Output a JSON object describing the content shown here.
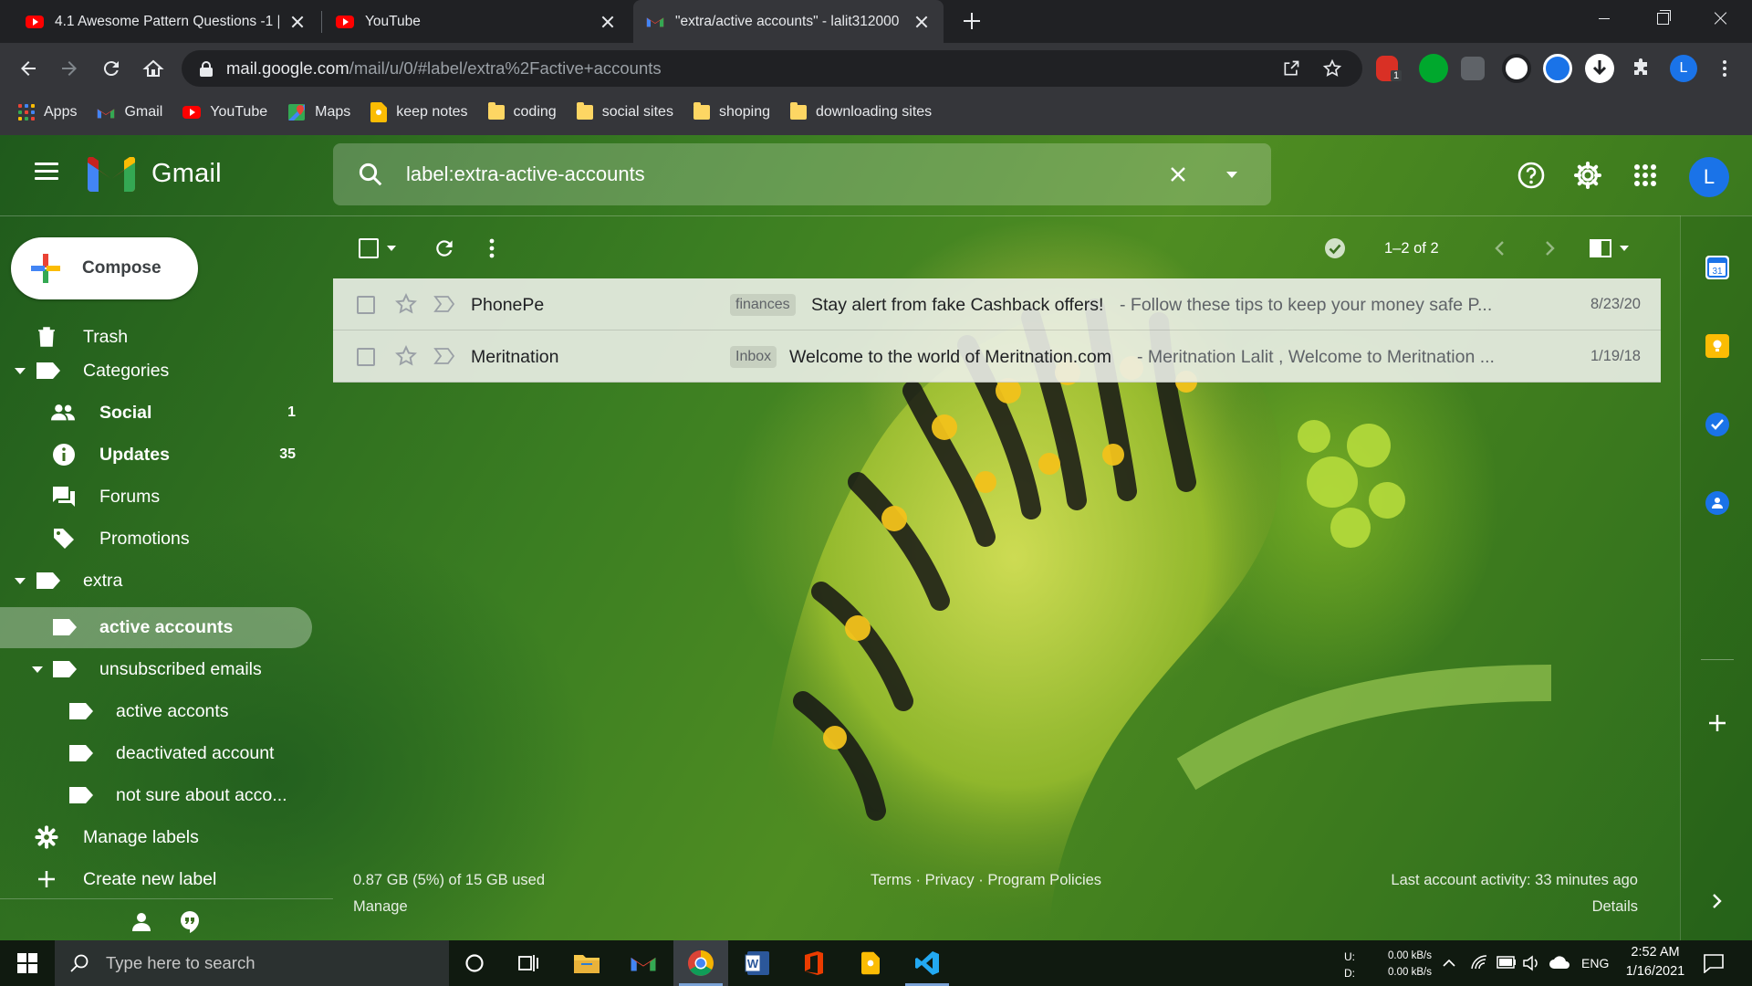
{
  "browser": {
    "tabs": [
      {
        "title": "4.1 Awesome Pattern Questions -1 |",
        "favicon": "youtube-icon",
        "active": false
      },
      {
        "title": "YouTube",
        "favicon": "youtube-icon",
        "active": false
      },
      {
        "title": "\"extra/active accounts\" - lalit312000",
        "favicon": "gmail-icon",
        "active": true
      }
    ],
    "url_host": "mail.google.com",
    "url_path": "/mail/u/0/#label/extra%2Factive+accounts",
    "profile_initial": "L",
    "extension_badge": "1",
    "bookmarks": [
      {
        "label": "Apps",
        "icon": "apps-icon"
      },
      {
        "label": "Gmail",
        "icon": "gmail-icon"
      },
      {
        "label": "YouTube",
        "icon": "youtube-icon"
      },
      {
        "label": "Maps",
        "icon": "maps-icon"
      },
      {
        "label": "keep notes",
        "icon": "keep-icon"
      },
      {
        "label": "coding",
        "icon": "folder-icon"
      },
      {
        "label": "social sites",
        "icon": "folder-icon"
      },
      {
        "label": "shoping",
        "icon": "folder-icon"
      },
      {
        "label": "downloading sites",
        "icon": "folder-icon"
      }
    ]
  },
  "gmail": {
    "product_name": "Gmail",
    "search_value": "label:extra-active-accounts",
    "account_initial": "L",
    "compose_label": "Compose",
    "nav": {
      "trash": "Trash",
      "categories": "Categories",
      "social": {
        "label": "Social",
        "count": "1"
      },
      "updates": {
        "label": "Updates",
        "count": "35"
      },
      "forums": "Forums",
      "promotions": "Promotions",
      "extra": "extra",
      "active_accounts": "active accounts",
      "unsubscribed_emails": "unsubscribed emails",
      "active_acconts": "active acconts",
      "deactivated_account": "deactivated account",
      "not_sure": "not sure about acco...",
      "manage_labels": "Manage labels",
      "create_label": "Create new label"
    },
    "pager_text": "1–2 of 2",
    "emails": [
      {
        "sender": "PhonePe",
        "label": "finances",
        "subject": "Stay alert from fake Cashback offers!",
        "snippet": " - Follow these tips to keep your money safe P...",
        "date": "8/23/20"
      },
      {
        "sender": "Meritnation",
        "label": "Inbox",
        "subject": "Welcome to the world of Meritnation.com",
        "snippet": " - Meritnation Lalit , Welcome to Meritnation ...",
        "date": "1/19/18"
      }
    ],
    "footer": {
      "storage": "0.87 GB (5%) of 15 GB used",
      "manage": "Manage",
      "links": "Terms · Privacy · Program Policies",
      "activity": "Last account activity: 33 minutes ago",
      "details": "Details"
    }
  },
  "taskbar": {
    "search_placeholder": "Type here to search",
    "net_up_label": "U:",
    "net_down_label": "D:",
    "net_up": "0.00 kB/s",
    "net_down": "0.00 kB/s",
    "language": "ENG",
    "time": "2:52 AM",
    "date": "1/16/2021"
  },
  "colors": {
    "gmail_red": "#ea4335",
    "accent_blue": "#1a73e8"
  }
}
